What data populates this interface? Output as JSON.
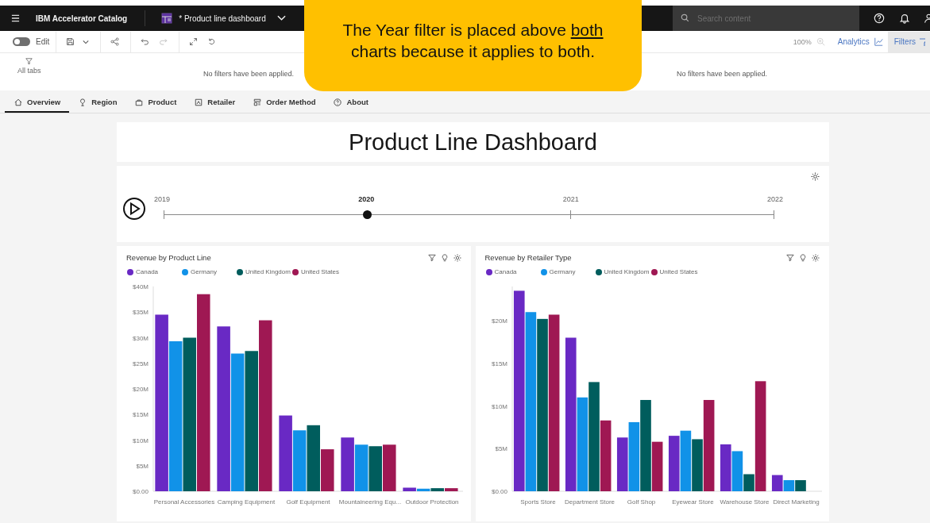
{
  "topbar": {
    "app_name": "IBM Accelerator Catalog",
    "dashboard_title": "* Product line dashboard",
    "search": {
      "placeholder": "Search content"
    }
  },
  "toolbar": {
    "edit_toggle": {
      "label": "Edit",
      "on": false
    },
    "zoom": "100%",
    "analytics": "Analytics",
    "filters": "Filters"
  },
  "filter_bar": {
    "all_tabs": "All tabs",
    "messages": [
      "No filters have been applied.",
      "No filters have been applied."
    ]
  },
  "tabs": [
    {
      "label": "Overview",
      "selected": true
    },
    {
      "label": "Region",
      "selected": false
    },
    {
      "label": "Product",
      "selected": false
    },
    {
      "label": "Retailer",
      "selected": false
    },
    {
      "label": "Order Method",
      "selected": false
    },
    {
      "label": "About",
      "selected": false
    }
  ],
  "title": "Product Line Dashboard",
  "timeline": {
    "years": [
      {
        "label": "2019",
        "selected": false
      },
      {
        "label": "2020",
        "selected": true
      },
      {
        "label": "2021",
        "selected": false
      },
      {
        "label": "2022",
        "selected": false
      }
    ]
  },
  "charts": [
    {
      "title": "Revenue by Product Line",
      "chart_data": {
        "type": "bar",
        "categories": [
          "Personal Accessories",
          "Camping Equipment",
          "Golf Equipment",
          "Mountaineering Equ...",
          "Outdoor Protection"
        ],
        "ylim": [
          0,
          40
        ],
        "yticks": [
          {
            "value": 0,
            "label": "$0.00"
          },
          {
            "value": 5,
            "label": "$5M"
          },
          {
            "value": 10,
            "label": "$10M"
          },
          {
            "value": 15,
            "label": "$15M"
          },
          {
            "value": 20,
            "label": "$20M"
          },
          {
            "value": 25,
            "label": "$25M"
          },
          {
            "value": 30,
            "label": "$30M"
          },
          {
            "value": 35,
            "label": "$35M"
          },
          {
            "value": 40,
            "label": "$40M"
          }
        ],
        "series": [
          {
            "name": "Canada",
            "color": "#6929c4",
            "values": [
              34.5,
              32.2,
              14.8,
              10.5,
              0.7
            ]
          },
          {
            "name": "Germany",
            "color": "#1192e8",
            "values": [
              29.3,
              26.9,
              11.9,
              9.1,
              0.5
            ]
          },
          {
            "name": "United Kingdom",
            "color": "#005d5d",
            "values": [
              30.0,
              27.4,
              12.9,
              8.8,
              0.6
            ]
          },
          {
            "name": "United States",
            "color": "#9f1853",
            "values": [
              38.5,
              33.4,
              8.2,
              9.1,
              0.6
            ]
          }
        ]
      }
    },
    {
      "title": "Revenue by Retailer Type",
      "chart_data": {
        "type": "bar",
        "categories": [
          "Sports Store",
          "Department Store",
          "Golf Shop",
          "Eyewear Store",
          "Warehouse Store",
          "Direct Marketing"
        ],
        "ylim": [
          0,
          24
        ],
        "yticks": [
          {
            "value": 0,
            "label": "$0.00"
          },
          {
            "value": 5,
            "label": "$5M"
          },
          {
            "value": 10,
            "label": "$10M"
          },
          {
            "value": 15,
            "label": "$15M"
          },
          {
            "value": 20,
            "label": "$20M"
          }
        ],
        "series": [
          {
            "name": "Canada",
            "color": "#6929c4",
            "values": [
              23.5,
              18.0,
              6.3,
              6.5,
              5.5,
              1.9
            ]
          },
          {
            "name": "Germany",
            "color": "#1192e8",
            "values": [
              21.0,
              11.0,
              8.1,
              7.1,
              4.7,
              1.3
            ]
          },
          {
            "name": "United Kingdom",
            "color": "#005d5d",
            "values": [
              20.2,
              12.8,
              10.7,
              6.1,
              2.0,
              1.3
            ]
          },
          {
            "name": "United States",
            "color": "#9f1853",
            "values": [
              20.7,
              8.3,
              5.8,
              10.7,
              12.9,
              null
            ]
          }
        ]
      }
    }
  ],
  "callout": {
    "text_before": "The Year filter is placed above ",
    "emphasis": "both",
    "text_after": " charts because it applies to both."
  }
}
